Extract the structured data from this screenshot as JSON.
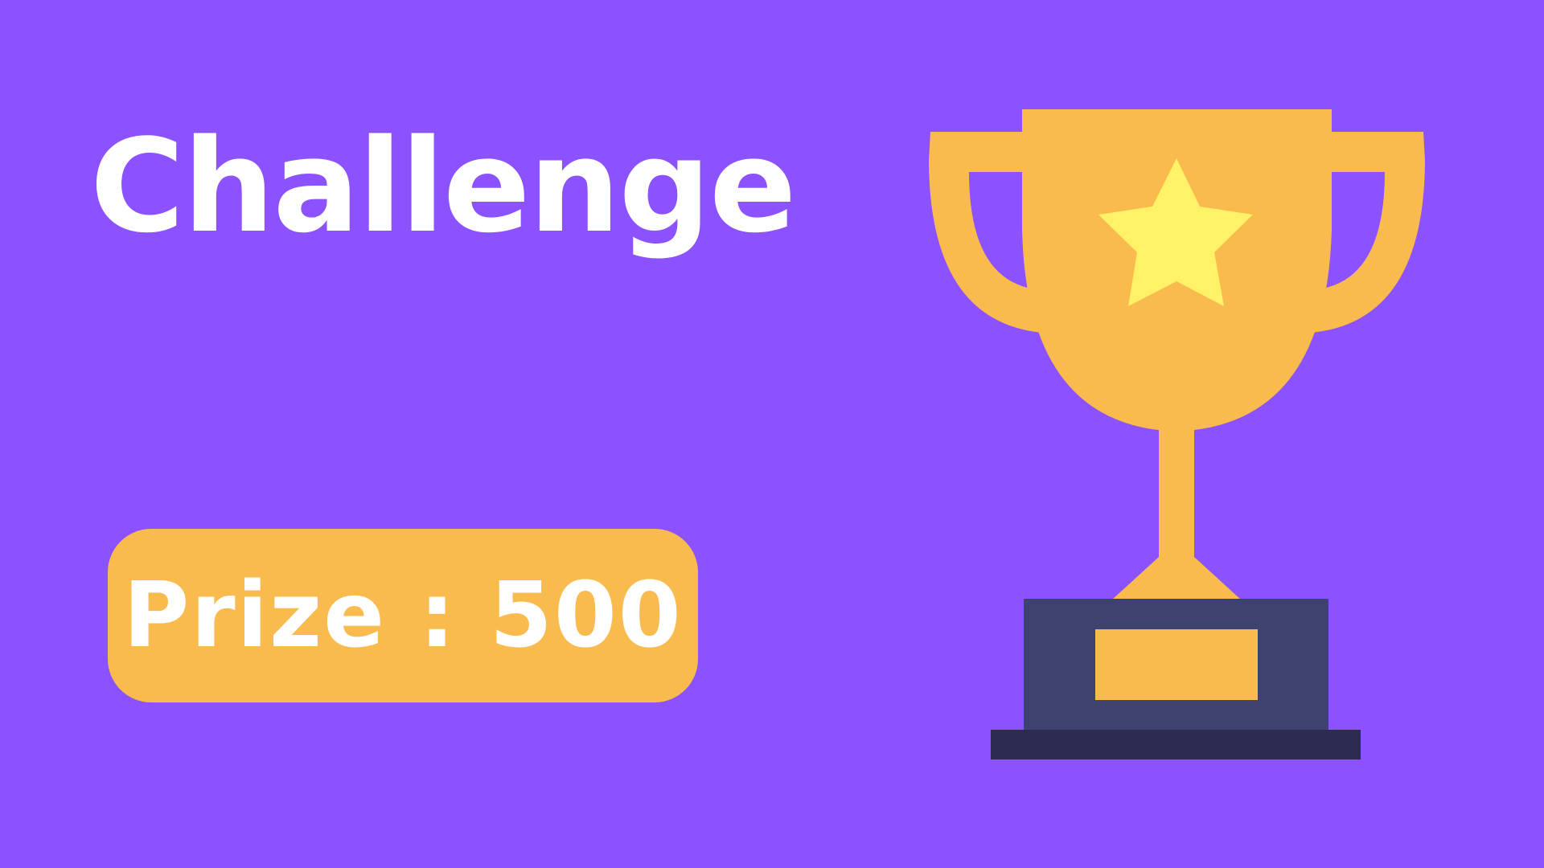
{
  "page": {
    "background_color": "#8c52ff"
  },
  "heading": {
    "title": "Challenge"
  },
  "prize": {
    "text": "Prize : 500",
    "pill_color": "#f9bb4e",
    "text_color": "#ffffff"
  },
  "trophy": {
    "icon": "trophy-icon",
    "cup_color": "#f9bb4e",
    "star_icon": "star-icon",
    "star_color": "#fff266",
    "base_color": "#3d4270",
    "plinth_color": "#2c2b51"
  }
}
